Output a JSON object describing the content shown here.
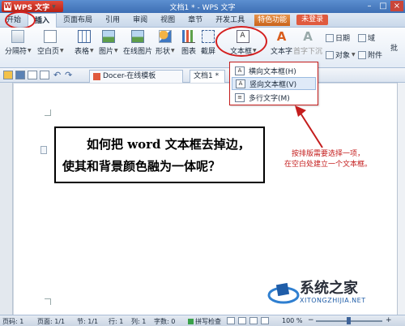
{
  "titlebar": {
    "app_name": "WPS 文字",
    "doc_title": "文档1 * - WPS 文字"
  },
  "menu": {
    "tabs": [
      "开始",
      "插入",
      "页面布局",
      "引用",
      "审阅",
      "视图",
      "章节",
      "开发工具"
    ],
    "special": "特色功能",
    "login": "未登录"
  },
  "ribbon": {
    "separator": "分隔符",
    "blank_page": "空白页",
    "table": "表格",
    "picture": "图片",
    "online_picture": "在线图片",
    "shape": "形状",
    "chart": "图表",
    "screenshot": "截屏",
    "textbox": "文本框",
    "art_text": "艺术字",
    "drop_cap": "首字下沉",
    "text_box_small": "文本字",
    "date": "日期",
    "field": "域",
    "object": "对象",
    "attachment": "附件",
    "more": "批"
  },
  "doctabs": {
    "docer": "Docer-在线模板",
    "doc1": "文档1 *"
  },
  "dropdown": {
    "items": [
      {
        "label": "横向文本框(H)"
      },
      {
        "label": "竖向文本框(V)"
      },
      {
        "label": "多行文字(M)"
      }
    ]
  },
  "document": {
    "line1": "如何把 word 文本框去掉边，",
    "line2": "使其和背景颜色融为一体呢？"
  },
  "annotation": {
    "line1": "按排版需要选择一项，",
    "line2": "在空白处建立一个文本框。"
  },
  "watermark": {
    "title": "系统之家",
    "url": "XITONGZHIJIA.NET"
  },
  "status": {
    "page_no": "页码: 1",
    "page": "页面: 1/1",
    "section": "节: 1/1",
    "row": "行: 1",
    "col": "列: 1",
    "words": "字数: 0",
    "spellcheck": "拼写检查",
    "zoom": "100 %"
  },
  "colors": {
    "accent_red": "#c41d1d",
    "title_blue": "#3d6fb4"
  }
}
